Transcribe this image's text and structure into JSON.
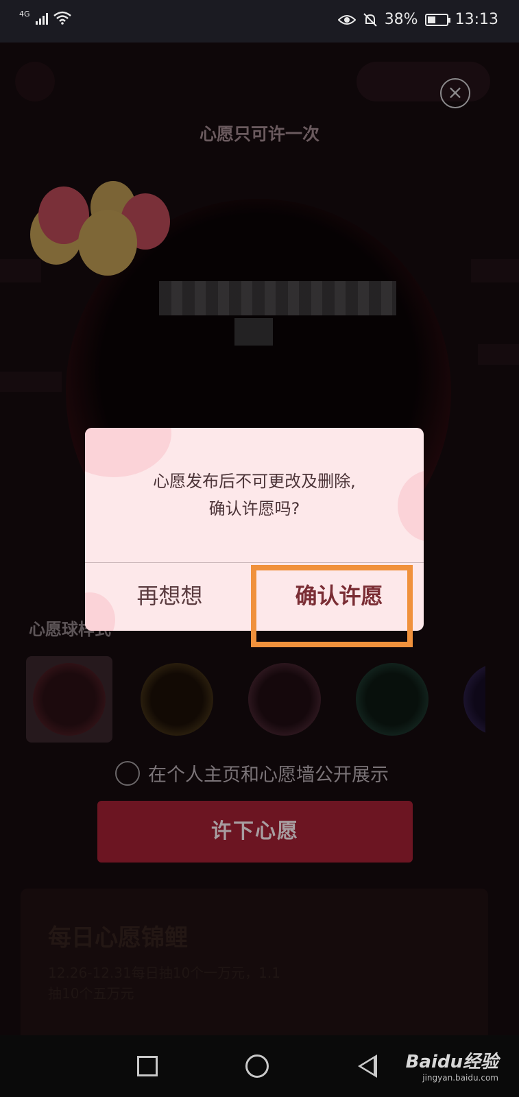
{
  "status_bar": {
    "network": "4G",
    "battery_percent": "38%",
    "time": "13:13",
    "icons": [
      "signal-icon",
      "wifi-icon",
      "eye-icon",
      "mute-icon",
      "battery-icon"
    ]
  },
  "background_page": {
    "wish_once_title": "心愿只可许一次",
    "skin_section_label": "心愿球样式",
    "public_option_label": "在个人主页和心愿墙公开展示",
    "make_wish_button": "许下心愿",
    "daily_card": {
      "title": "每日心愿锦鲤",
      "description": "12.26-12.31每日抽10个一万元，1.1抽10个五万元"
    }
  },
  "dialog": {
    "message_line1": "心愿发布后不可更改及删除,",
    "message_line2": "确认许愿吗?",
    "cancel_label": "再想想",
    "confirm_label": "确认许愿"
  },
  "navigation_bar": {
    "icons": [
      "recent-apps-icon",
      "home-icon",
      "back-icon"
    ]
  },
  "watermark": {
    "main": "Baidu经验",
    "sub": "jingyan.baidu.com"
  },
  "colors": {
    "highlight": "#f0913c",
    "dialog_bg": "#fde8ea",
    "button_dim": "#6c1522"
  }
}
